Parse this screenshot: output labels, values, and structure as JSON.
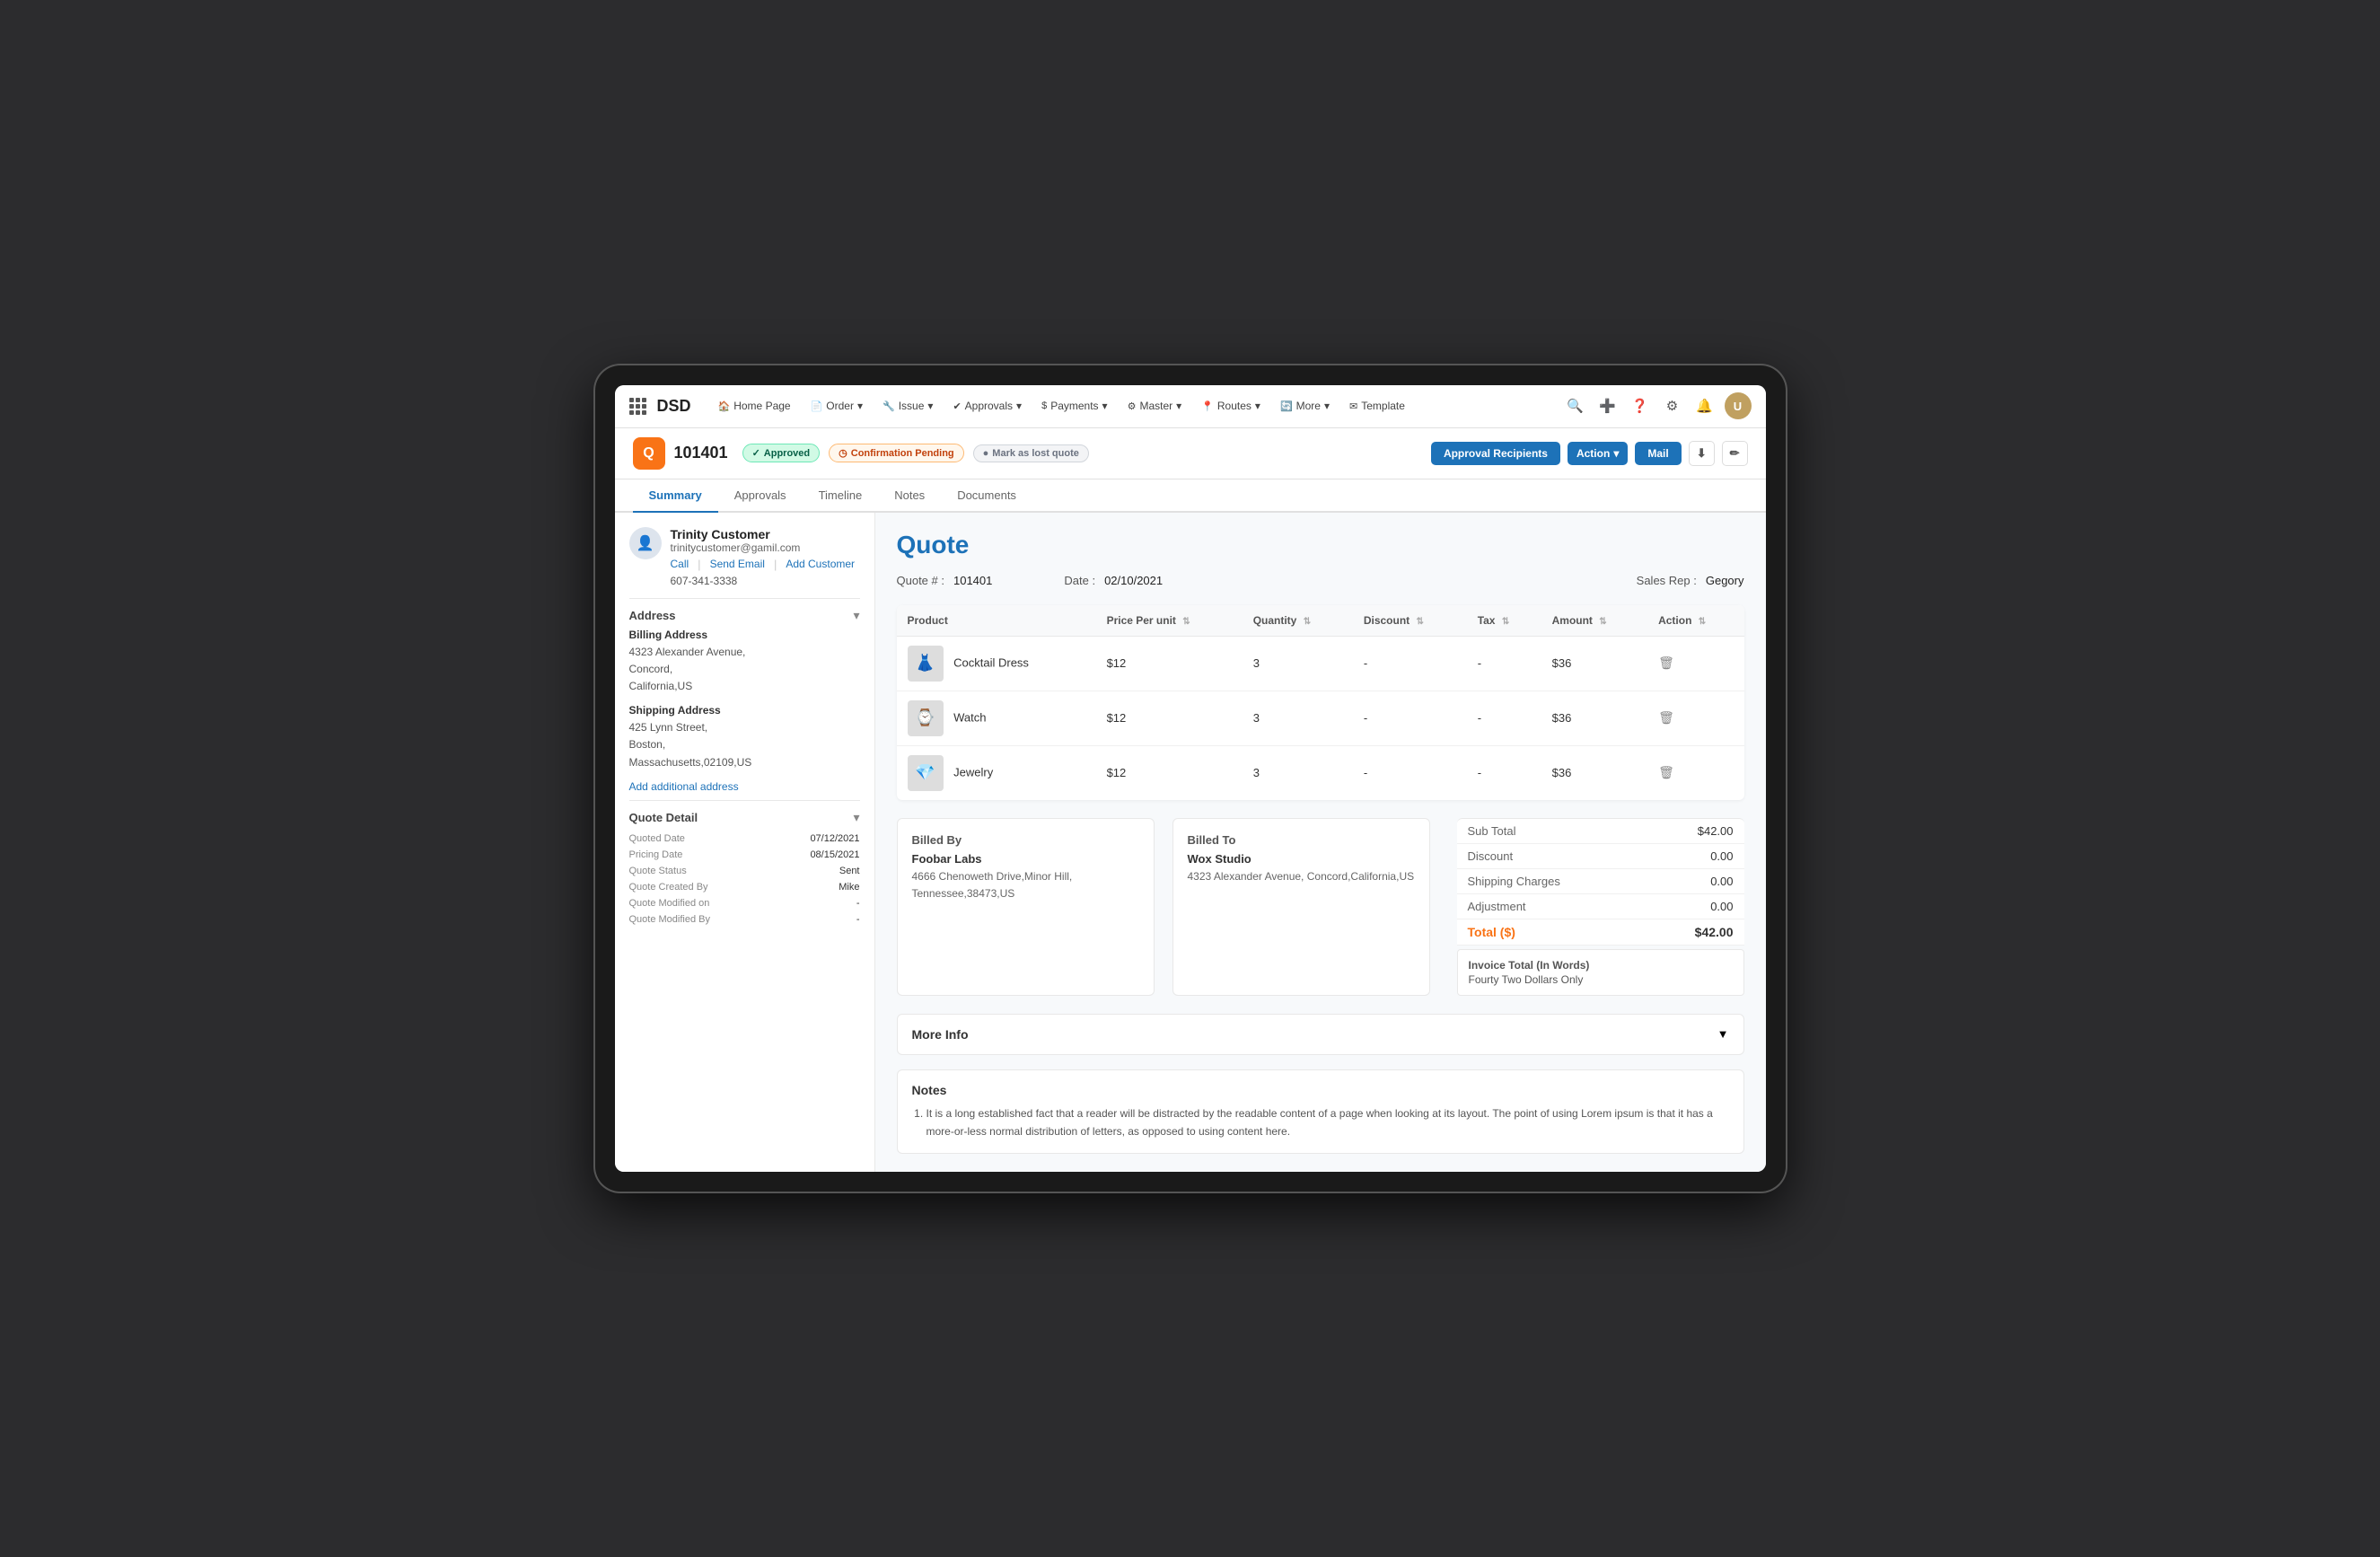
{
  "nav": {
    "brand": "DSD",
    "items": [
      {
        "label": "Home Page",
        "icon": "🏠"
      },
      {
        "label": "Order",
        "icon": "📄",
        "has_dropdown": true
      },
      {
        "label": "Issue",
        "icon": "🔧",
        "has_dropdown": true
      },
      {
        "label": "Approvals",
        "icon": "✔",
        "has_dropdown": true
      },
      {
        "label": "Payments",
        "icon": "$",
        "has_dropdown": true
      },
      {
        "label": "Master",
        "icon": "⚙",
        "has_dropdown": true
      },
      {
        "label": "Routes",
        "icon": "📍",
        "has_dropdown": true
      },
      {
        "label": "More",
        "icon": "🔄",
        "has_dropdown": true
      },
      {
        "label": "Template",
        "icon": "✉"
      }
    ]
  },
  "record": {
    "id": "101401",
    "icon_text": "Q",
    "badge_approved": "Approved",
    "badge_confirmation": "Confirmation Pending",
    "badge_lost": "Mark as lost quote",
    "btn_approval_recipients": "Approval Recipients",
    "btn_action": "Action",
    "btn_mail": "Mail",
    "btn_download": "⬇",
    "btn_edit": "✏"
  },
  "tabs": [
    {
      "label": "Summary",
      "active": true
    },
    {
      "label": "Approvals",
      "active": false
    },
    {
      "label": "Timeline",
      "active": false
    },
    {
      "label": "Notes",
      "active": false
    },
    {
      "label": "Documents",
      "active": false
    }
  ],
  "customer": {
    "name": "Trinity Customer",
    "email": "trinitycustomer@gamil.com",
    "phone": "607-341-3338",
    "avatar_icon": "👤",
    "action_call": "Call",
    "action_send_email": "Send Email",
    "action_add_customer": "Add Customer"
  },
  "address": {
    "section_title": "Address",
    "billing_label": "Billing Address",
    "billing_lines": [
      "4323 Alexander Avenue,",
      "Concord,",
      "California,US"
    ],
    "shipping_label": "Shipping Address",
    "shipping_lines": [
      "425 Lynn Street,",
      "Boston,",
      "Massachusetts,02109,US"
    ],
    "add_link": "Add additional address"
  },
  "quote_detail": {
    "section_title": "Quote Detail",
    "rows": [
      {
        "label": "Quoted Date",
        "value": "07/12/2021"
      },
      {
        "label": "Pricing Date",
        "value": "08/15/2021"
      },
      {
        "label": "Quote Status",
        "value": "Sent"
      },
      {
        "label": "Quote Created By",
        "value": "Mike"
      },
      {
        "label": "Quote Modified on",
        "value": "-"
      },
      {
        "label": "Quote Modified By",
        "value": "-"
      }
    ]
  },
  "quote": {
    "title": "Quote",
    "quote_number_label": "Quote # :",
    "quote_number_value": "101401",
    "date_label": "Date :",
    "date_value": "02/10/2021",
    "sales_rep_label": "Sales Rep :",
    "sales_rep_value": "Gegory"
  },
  "table": {
    "headers": [
      "Product",
      "Price Per unit",
      "Quantity",
      "Discount",
      "Tax",
      "Amount",
      "Action"
    ],
    "rows": [
      {
        "product": "Cocktail Dress",
        "icon": "👗",
        "price": "$12",
        "qty": "3",
        "discount": "-",
        "tax": "-",
        "amount": "$36"
      },
      {
        "product": "Watch",
        "icon": "⌚",
        "price": "$12",
        "qty": "3",
        "discount": "-",
        "tax": "-",
        "amount": "$36"
      },
      {
        "product": "Jewelry",
        "icon": "💎",
        "price": "$12",
        "qty": "3",
        "discount": "-",
        "tax": "-",
        "amount": "$36"
      }
    ]
  },
  "billed_by": {
    "title": "Billed By",
    "name": "Foobar Labs",
    "address": "4666 Chenoweth Drive,Minor Hill, Tennessee,38473,US"
  },
  "billed_to": {
    "title": "Billed To",
    "name": "Wox Studio",
    "address": "4323 Alexander Avenue, Concord,California,US"
  },
  "totals": {
    "sub_total_label": "Sub Total",
    "sub_total_value": "$42.00",
    "discount_label": "Discount",
    "discount_value": "0.00",
    "shipping_label": "Shipping Charges",
    "shipping_value": "0.00",
    "adjustment_label": "Adjustment",
    "adjustment_value": "0.00",
    "grand_total_label": "Total ($)",
    "grand_total_value": "$42.00",
    "invoice_words_label": "Invoice Total (In Words)",
    "invoice_words_value": "Fourty Two Dollars Only"
  },
  "more_info": {
    "title": "More Info",
    "toggle": "▼"
  },
  "notes": {
    "title": "Notes",
    "items": [
      "It is a long established fact that a reader will be distracted by the readable content of a page when looking at its layout. The point of using Lorem ipsum is that it has a more-or-less normal distribution of letters, as opposed to using content here."
    ]
  }
}
